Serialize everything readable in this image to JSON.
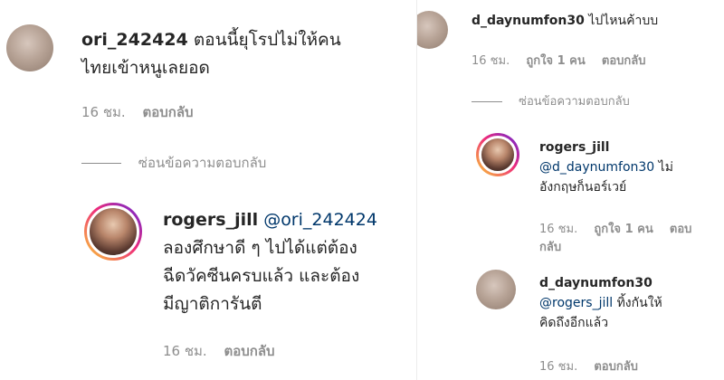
{
  "left": {
    "comment": {
      "username": "ori_242424",
      "text_line1": "ตอนนี้ยุโรปไม่ให้คน",
      "text_line2": "ไทยเข้าหนูเลยอด",
      "time": "16 ชม.",
      "reply": "ตอบกลับ"
    },
    "hide_replies": "ซ่อนข้อความตอบกลับ",
    "reply": {
      "username": "rogers_jill",
      "mention": "@ori_242424",
      "text_line1": "ลองศึกษาดี ๆ ไปได้แต่ต้อง",
      "text_line2": "ฉีดวัคซีนครบแล้ว และต้อง",
      "text_line3": "มีญาติการันตี",
      "time": "16 ชม.",
      "reply": "ตอบกลับ"
    }
  },
  "right": {
    "comment": {
      "username": "d_daynumfon30",
      "text": "ไปไหนค้าบบ",
      "time": "16 ชม.",
      "likes": "ถูกใจ 1 คน",
      "reply": "ตอบกลับ"
    },
    "hide_replies": "ซ่อนข้อความตอบกลับ",
    "reply1": {
      "username": "rogers_jill",
      "mention": "@d_daynumfon30",
      "text_tail": "ไม่",
      "text_line2": "อังกฤษก็นอร์เวย์",
      "time": "16 ชม.",
      "likes": "ถูกใจ 1 คน",
      "reply": "ตอบกลับ"
    },
    "reply2": {
      "username": "d_daynumfon30",
      "mention": "@rogers_jill",
      "text_tail": "ทิ้งกันให้",
      "text_line2": "คิดถึงอีกแล้ว",
      "time": "16 ชม.",
      "reply": "ตอบกลับ"
    }
  }
}
